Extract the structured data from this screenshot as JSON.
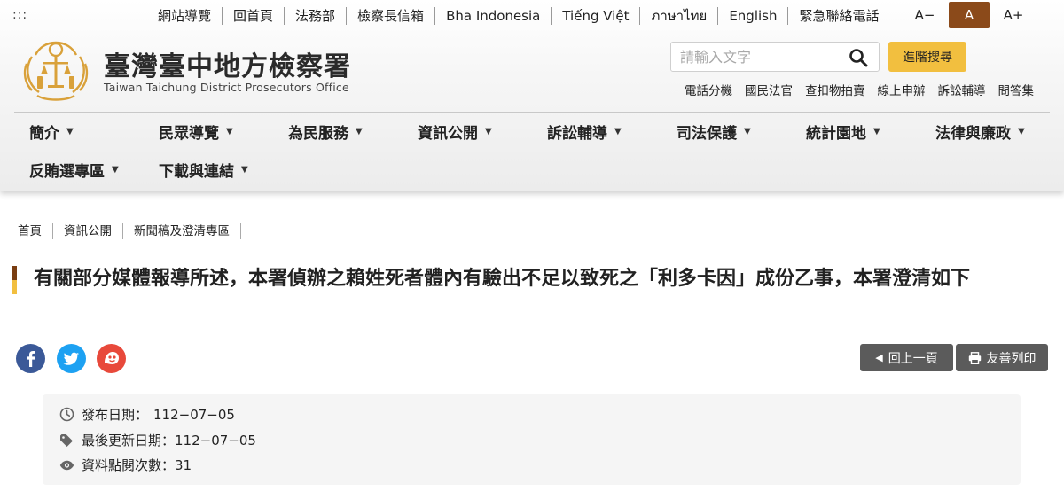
{
  "header": {
    "access_key": ":::",
    "top_links": [
      "網站導覽",
      "回首頁",
      "法務部",
      "檢察長信箱",
      "Bha Indonesia",
      "Tiếng Việt",
      "ภาษาไทย",
      "English",
      "緊急聯絡電話"
    ],
    "font_sizes": [
      "A−",
      "A",
      "A+"
    ],
    "site_name": "臺灣臺中地方檢察署",
    "site_name_en": "Taiwan Taichung District Prosecutors Office",
    "search_placeholder": "請輸入文字",
    "advanced_search": "進階搜尋",
    "quick_links": [
      "電話分機",
      "國民法官",
      "查扣物拍賣",
      "線上申辦",
      "訴訟輔導",
      "問答集"
    ]
  },
  "nav": {
    "row1": [
      "簡介",
      "民眾導覽",
      "為民服務",
      "資訊公開",
      "訴訟輔導",
      "司法保護",
      "統計園地",
      "法律與廉政"
    ],
    "row2": [
      "反賄選專區",
      "下載與連結"
    ]
  },
  "breadcrumb": [
    "首頁",
    "資訊公開",
    "新聞稿及澄清專區"
  ],
  "article": {
    "title": "有關部分媒體報導所述，本署偵辦之賴姓死者體內有驗出不足以致死之「利多卡因」成份乙事，本署澄清如下",
    "back_label": "回上一頁",
    "print_label": "友善列印",
    "publish_date_label": "發布日期：",
    "publish_date": "112−07−05",
    "updated_label": "最後更新日期：",
    "updated_date": "112−07−05",
    "views_label": "資料點閱次數：",
    "views": "31"
  },
  "colors": {
    "brand_brown": "#8b4a1a",
    "accent_yellow": "#f2bf3f",
    "button_gray": "#5b5b5b",
    "facebook": "#3b5998",
    "twitter": "#1da1f2",
    "plurk": "#e8493b"
  }
}
